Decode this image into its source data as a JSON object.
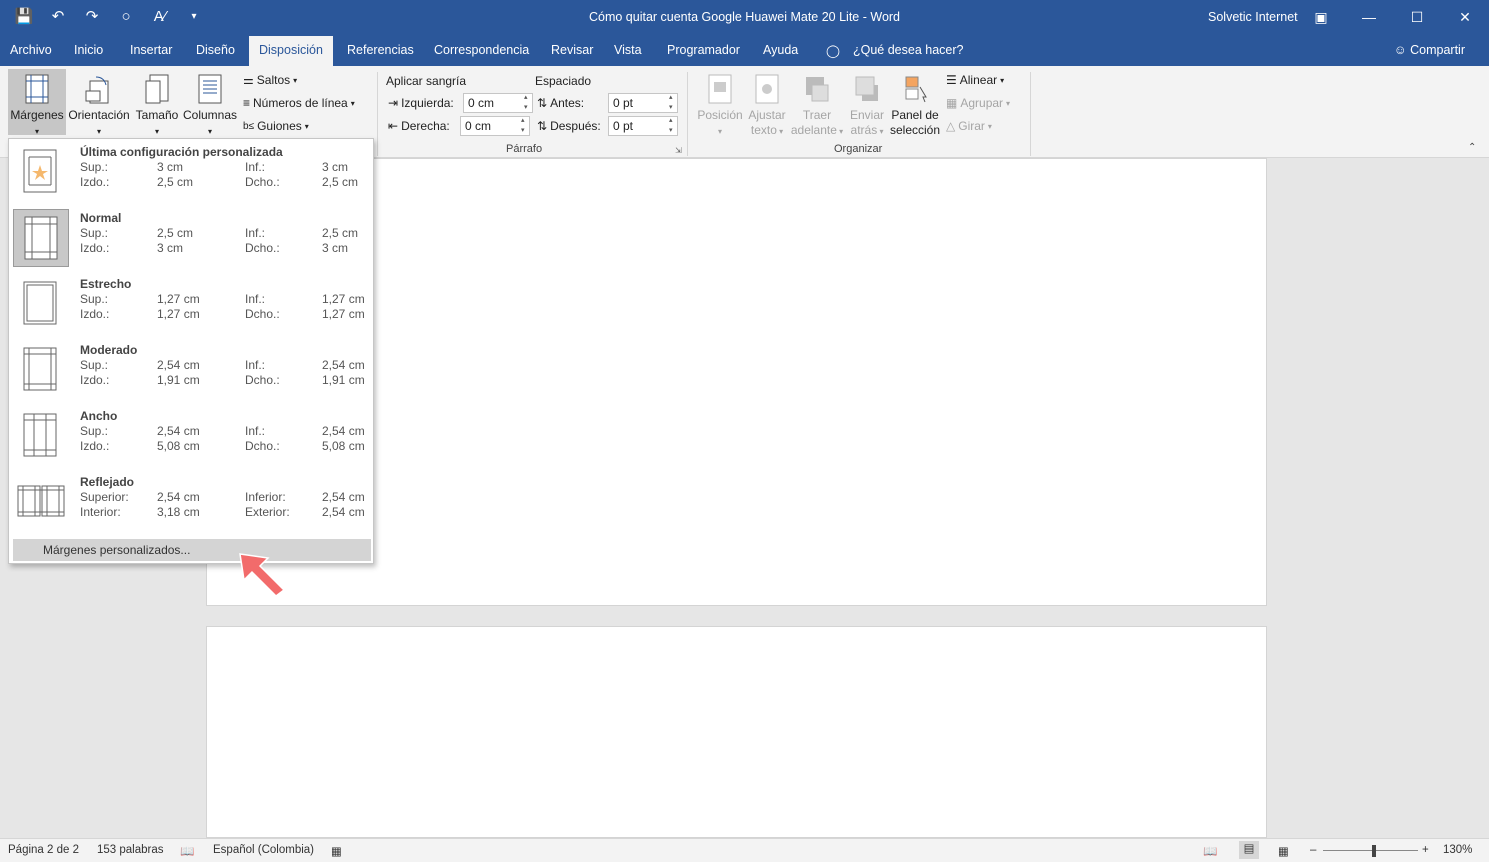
{
  "title": "Cómo quitar cuenta Google Huawei Mate 20 Lite  -  Word",
  "user": "Solvetic Internet",
  "tabs": [
    "Archivo",
    "Inicio",
    "Insertar",
    "Diseño",
    "Disposición",
    "Referencias",
    "Correspondencia",
    "Revisar",
    "Vista",
    "Programador",
    "Ayuda"
  ],
  "tell_me": "¿Qué desea hacer?",
  "share": "Compartir",
  "ribbon": {
    "margenes": "Márgenes",
    "orientacion": "Orientación",
    "tamano": "Tamaño",
    "columnas": "Columnas",
    "saltos": "Saltos",
    "numeros": "Números de línea",
    "guiones": "Guiones",
    "aplicar_sangria": "Aplicar sangría",
    "espaciado": "Espaciado",
    "izquierda": "Izquierda:",
    "izquierda_val": "0 cm",
    "derecha": "Derecha:",
    "derecha_val": "0 cm",
    "antes": "Antes:",
    "antes_val": "0 pt",
    "despues": "Después:",
    "despues_val": "0 pt",
    "parrafo": "Párrafo",
    "posicion": "Posición",
    "ajustar_texto_1": "Ajustar",
    "ajustar_texto_2": "texto",
    "traer_1": "Traer",
    "traer_2": "adelante",
    "enviar_1": "Enviar",
    "enviar_2": "atrás",
    "panel_1": "Panel de",
    "panel_2": "selección",
    "alinear": "Alinear",
    "agrupar": "Agrupar",
    "girar": "Girar",
    "organizar": "Organizar"
  },
  "margins": [
    {
      "name": "Última configuración personalizada",
      "k1": "Sup.:",
      "v1": "3 cm",
      "k2": "Inf.:",
      "v2": "3 cm",
      "k3": "Izdo.:",
      "v3": "2,5 cm",
      "k4": "Dcho.:",
      "v4": "2,5 cm"
    },
    {
      "name": "Normal",
      "k1": "Sup.:",
      "v1": "2,5 cm",
      "k2": "Inf.:",
      "v2": "2,5 cm",
      "k3": "Izdo.:",
      "v3": "3 cm",
      "k4": "Dcho.:",
      "v4": "3 cm"
    },
    {
      "name": "Estrecho",
      "k1": "Sup.:",
      "v1": "1,27 cm",
      "k2": "Inf.:",
      "v2": "1,27 cm",
      "k3": "Izdo.:",
      "v3": "1,27 cm",
      "k4": "Dcho.:",
      "v4": "1,27 cm"
    },
    {
      "name": "Moderado",
      "k1": "Sup.:",
      "v1": "2,54 cm",
      "k2": "Inf.:",
      "v2": "2,54 cm",
      "k3": "Izdo.:",
      "v3": "1,91 cm",
      "k4": "Dcho.:",
      "v4": "1,91 cm"
    },
    {
      "name": "Ancho",
      "k1": "Sup.:",
      "v1": "2,54 cm",
      "k2": "Inf.:",
      "v2": "2,54 cm",
      "k3": "Izdo.:",
      "v3": "5,08 cm",
      "k4": "Dcho.:",
      "v4": "5,08 cm"
    },
    {
      "name": "Reflejado",
      "k1": "Superior:",
      "v1": "2,54 cm",
      "k2": "Inferior:",
      "v2": "2,54 cm",
      "k3": "Interior:",
      "v3": "3,18 cm",
      "k4": "Exterior:",
      "v4": "2,54 cm"
    }
  ],
  "custom_margins": "Márgenes personalizados...",
  "status": {
    "page": "Página 2 de 2",
    "words": "153 palabras",
    "lang": "Español (Colombia)",
    "zoom": "130%"
  },
  "colors": {
    "accent": "#2b579a",
    "arrow": "#f26b6b"
  }
}
